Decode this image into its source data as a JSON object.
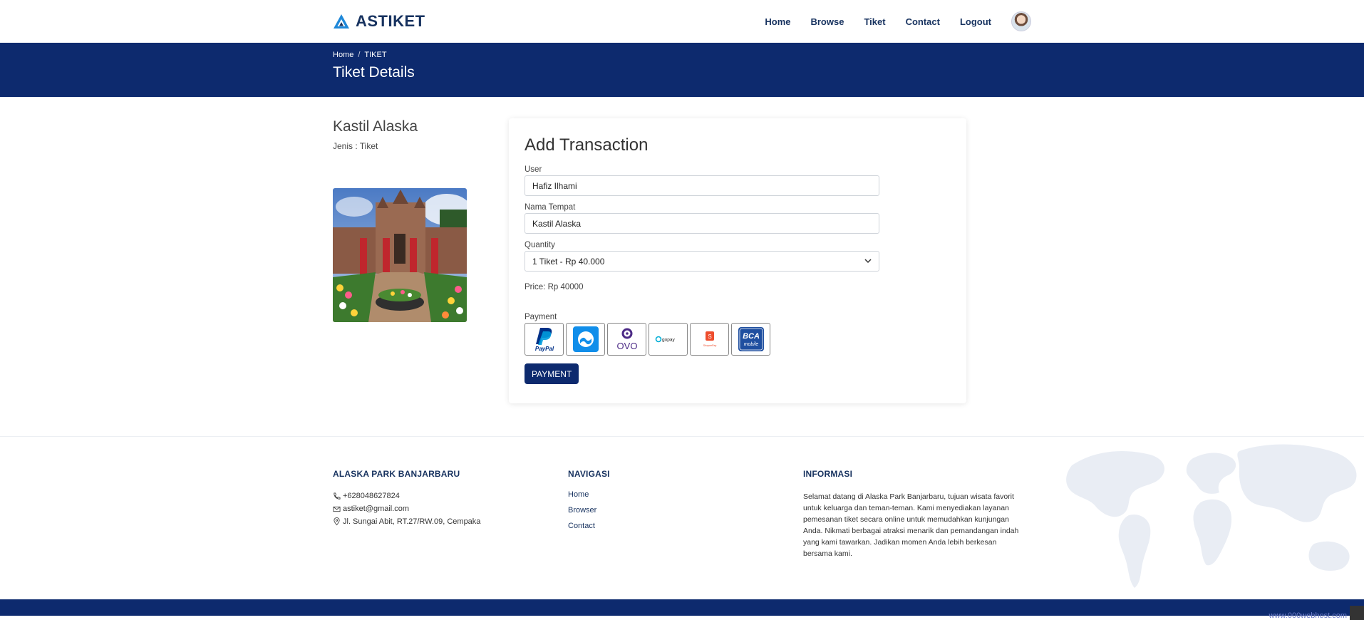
{
  "brand": {
    "name": "ASTIKET"
  },
  "nav": [
    "Home",
    "Browse",
    "Tiket",
    "Contact",
    "Logout"
  ],
  "breadcrumb": {
    "home": "Home",
    "separator": "/",
    "current": "TIKET"
  },
  "hero": {
    "title": "Tiket Details"
  },
  "place": {
    "name": "Kastil Alaska",
    "type": "Jenis : Tiket"
  },
  "form": {
    "title": "Add Transaction",
    "user_label": "User",
    "user_value": "Hafiz Ilhami",
    "place_label": "Nama Tempat",
    "place_value": "Kastil Alaska",
    "quantity_label": "Quantity",
    "quantity_value": "1 Tiket - Rp 40.000",
    "price": "Price: Rp 40000",
    "payment_label": "Payment",
    "payment_methods": [
      {
        "icon": "paypal-icon",
        "text": "PayPal"
      },
      {
        "icon": "dana-icon",
        "text": ""
      },
      {
        "icon": "ovo-icon",
        "text": "OVO"
      },
      {
        "icon": "gopay-icon",
        "text": "gopay"
      },
      {
        "icon": "shopeepay-icon",
        "text": "ShopeePay"
      },
      {
        "icon": "bca-mobile-icon",
        "text": "BCA"
      }
    ],
    "payment_button": "PAYMENT"
  },
  "footer": {
    "col1": {
      "title": "ALASKA PARK BANJARBARU",
      "phone": "+628048627824",
      "email": "astiket@gmail.com",
      "address": "Jl. Sungai Abit, RT.27/RW.09, Cempaka"
    },
    "col2": {
      "title": "NAVIGASI",
      "links": [
        "Home",
        "Browser",
        "Contact"
      ]
    },
    "col3": {
      "title": "INFORMASI",
      "text": "Selamat datang di Alaska Park Banjarbaru, tujuan wisata favorit untuk keluarga dan teman-teman. Kami menyediakan layanan pemesanan tiket secara online untuk memudahkan kunjungan Anda. Nikmati berbagai atraksi menarik dan pemandangan indah yang kami tawarkan. Jadikan momen Anda lebih berkesan bersama kami."
    }
  },
  "host_link": "www.000webhost.com",
  "colors": {
    "primary": "#0d2a6e",
    "brand_text": "#17325f",
    "logo_blue": "#1e88d9"
  }
}
